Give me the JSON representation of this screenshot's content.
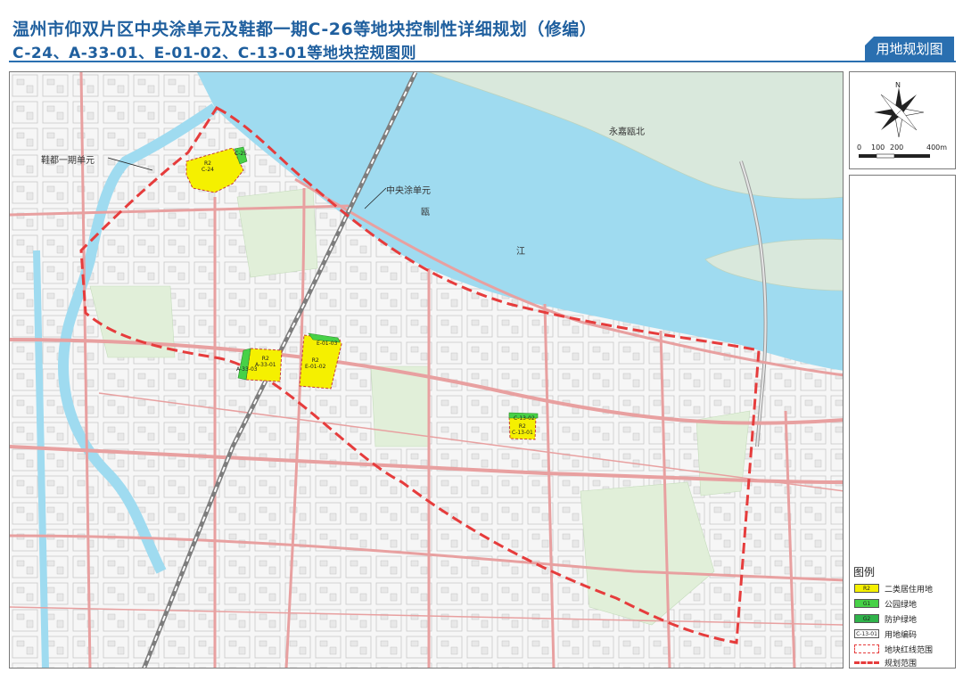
{
  "header": {
    "title_line1": "温州市仰双片区中央涂单元及鞋都一期C-26等地块控制性详细规划（修编）",
    "title_line2": "C-24、A-33-01、E-01-02、C-13-01等地块控规图则",
    "tag": "用地规划图"
  },
  "map": {
    "labels": {
      "yongjia": "永嘉瓯北",
      "ou": "瓯",
      "jiang": "江",
      "xiedu": "鞋都一期单元",
      "zhongyangtu": "中央涂单元"
    },
    "plots": {
      "c24_code": "R2",
      "c24": "C-24",
      "c24_green": "C-25",
      "a33_code": "R2",
      "a33": "A-33-01",
      "a33_green": "A-33-03",
      "e01_code": "R2",
      "e01": "E-01-02",
      "e01_green": "E-01-03",
      "c13_code": "R2",
      "c13": "C-13-01",
      "c13_green": "C-13-02"
    },
    "colors": {
      "water": "#9fdbf0",
      "river_land": "#d9e8dc",
      "green_park": "#e1efd9",
      "road": "#e8a0a0",
      "residential": "#f5f000",
      "green_g1": "#47d147",
      "boundary": "#e63c3c"
    }
  },
  "compass": {
    "north": "N",
    "scale": [
      "0",
      "100",
      "200",
      "400m"
    ]
  },
  "legend": {
    "title": "图例",
    "items": [
      {
        "code": "R2",
        "label": "二类居住用地",
        "color": "#f5f000"
      },
      {
        "code": "G1",
        "label": "公园绿地",
        "color": "#47d147"
      },
      {
        "code": "G2",
        "label": "防护绿地",
        "color": "#2fb34a"
      },
      {
        "code": "C-13-01",
        "label": "用地编码",
        "color": "#ffffff"
      },
      {
        "code": "",
        "label": "地块红线范围",
        "color": "#ffffff"
      },
      {
        "code": "",
        "label": "规划范围",
        "color": "#ffffff"
      }
    ]
  }
}
